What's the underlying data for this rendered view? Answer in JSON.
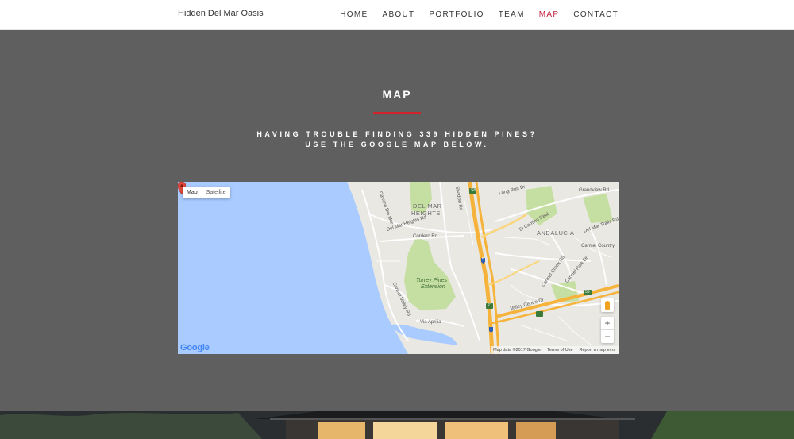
{
  "header": {
    "brand": "Hidden Del Mar Oasis",
    "nav": [
      {
        "label": "HOME",
        "active": false
      },
      {
        "label": "ABOUT",
        "active": false
      },
      {
        "label": "PORTFOLIO",
        "active": false
      },
      {
        "label": "TEAM",
        "active": false
      },
      {
        "label": "MAP",
        "active": true
      },
      {
        "label": "CONTACT",
        "active": false
      }
    ]
  },
  "section": {
    "title": "MAP",
    "subtitle": "HAVING TROUBLE FINDING 339 HIDDEN PINES? USE THE GOOGLE MAP BELOW."
  },
  "map": {
    "type_controls": {
      "map": "Map",
      "satellite": "Satellite"
    },
    "zoom": {
      "in": "+",
      "out": "−"
    },
    "logo": "Google",
    "attribution": {
      "data": "Map data ©2017 Google",
      "terms": "Terms of Use",
      "report": "Report a map error"
    },
    "labels": {
      "del_mar_heights_1": "DEL MAR",
      "del_mar_heights_2": "HEIGHTS",
      "andalucia": "ANDALUCIA",
      "torrey_1": "Torrey Pines",
      "torrey_2": "Extension",
      "cordero": "Cordero Rd",
      "del_mar_heights_rd": "Del Mar Heights Rd",
      "via_aprilia": "Via Aprilia",
      "carmel_valley": "Carmel Valley Rd",
      "valley_centre": "Valley Centre Dr",
      "camino_del_mar": "Camino Del Mar",
      "shadow_rd": "Shadow Rd",
      "long_run": "Long Run Dr",
      "grandview": "Grandview Rd",
      "el_camino": "El Camino Real",
      "carmel_country": "Carmel Country",
      "del_mar_trails": "Del Mar Trails Rd",
      "carmel_creek": "Carmel Creek Rd",
      "carmel_park": "Carmel Park Dr",
      "hwy_56": "56",
      "hwy_5": "5",
      "hwy_s8": "S8",
      "hwy_21": "21"
    },
    "colors": {
      "water": "#a9cbff",
      "land": "#e9e8e3",
      "park": "#c5dea1",
      "highway": "#f6b33c",
      "pin": "#e24b3c"
    }
  }
}
